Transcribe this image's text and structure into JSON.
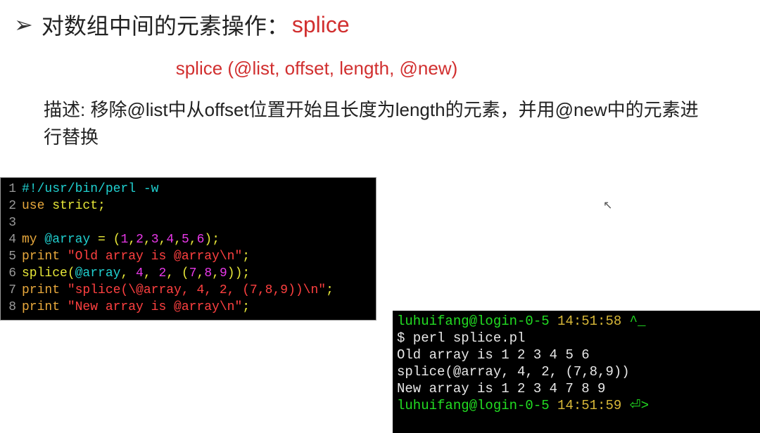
{
  "heading": {
    "bullet_glyph": "➢",
    "label": "对数组中间的元素操作：",
    "keyword": "splice"
  },
  "syntax_line": "splice (@list, offset, length, @new)",
  "description": "描述: 移除@list中从offset位置开始且长度为length的元素，并用@new中的元素进行替换",
  "editor": {
    "ln1": "1",
    "l1_comment": "#!/usr/bin/perl -w",
    "ln2": "2",
    "l2_use": "use",
    "l2_strict": " strict",
    "l2_semi": ";",
    "ln3": "3",
    "ln4": "4",
    "l4_my": "my",
    "l4_arr": " @array",
    "l4_eq": " = ",
    "l4_paren1": "(",
    "l4_n1": "1",
    "l4_c1": ",",
    "l4_n2": "2",
    "l4_c2": ",",
    "l4_n3": "3",
    "l4_c3": ",",
    "l4_n4": "4",
    "l4_c4": ",",
    "l4_n5": "5",
    "l4_c5": ",",
    "l4_n6": "6",
    "l4_paren2": ")",
    "l4_semi": ";",
    "ln5": "5",
    "l5_print": "print",
    "l5_str": " \"Old array is @array\\n\"",
    "l5_semi": ";",
    "ln6": "6",
    "l6_splice": "splice",
    "l6_paren1": "(",
    "l6_arr": "@array",
    "l6_c1": ", ",
    "l6_n1": "4",
    "l6_c2": ", ",
    "l6_n2": "2",
    "l6_c3": ", ",
    "l6_paren2": "(",
    "l6_n3": "7",
    "l6_c4": ",",
    "l6_n4": "8",
    "l6_c5": ",",
    "l6_n5": "9",
    "l6_paren3": ")",
    "l6_paren4": ")",
    "l6_semi": ";",
    "ln7": "7",
    "l7_print": "print",
    "l7_str": " \"splice(\\@array, 4, 2, (7,8,9))\\n\"",
    "l7_semi": ";",
    "ln8": "8",
    "l8_print": "print",
    "l8_str": " \"New array is @array\\n\"",
    "l8_semi": ";"
  },
  "terminal": {
    "prompt_user1": "luhuifang@login-0-5",
    "time1": " 14:51:58",
    "caret1": " ^_",
    "cmd_line": "$ perl splice.pl",
    "out1": "Old array is 1 2 3 4 5 6",
    "out2": "splice(@array, 4, 2, (7,8,9))",
    "out3": "New array is 1 2 3 4 7 8 9",
    "prompt_user2": "luhuifang@login-0-5",
    "time2": " 14:51:59",
    "caret2": " ⏎>"
  },
  "cursor_icon": "↖"
}
